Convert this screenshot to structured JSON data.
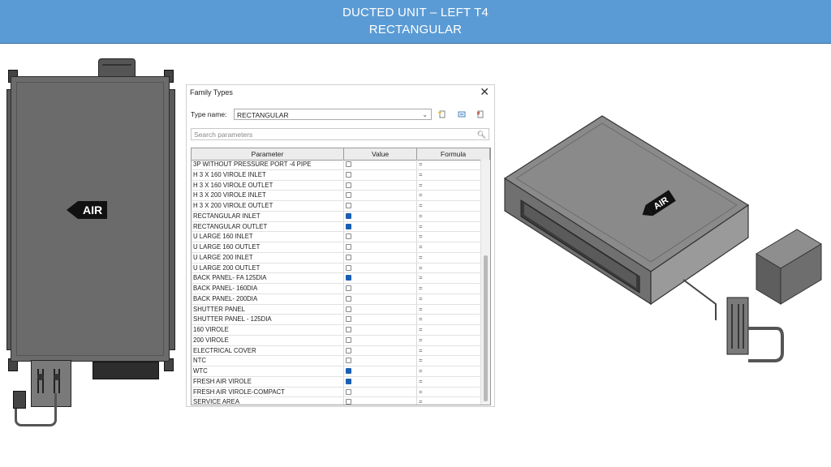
{
  "header": {
    "title_line1": "DUCTED UNIT – LEFT T4",
    "title_line2": "RECTANGULAR",
    "background": "#5b9bd5"
  },
  "front_view": {
    "air_label": "AIR"
  },
  "dialog": {
    "title": "Family Types",
    "type_name_label": "Type name:",
    "type_name_value": "RECTANGULAR",
    "search_placeholder": "Search parameters",
    "columns": {
      "parameter": "Parameter",
      "value": "Value",
      "formula": "Formula"
    },
    "rows": [
      {
        "name": "3P WITHOUT PRESSURE PORT -4  PIPE",
        "checked": false,
        "formula": "="
      },
      {
        "name": "H  3 X 160 VIROLE INLET",
        "checked": false,
        "formula": "="
      },
      {
        "name": "H  3 X 160 VIROLE OUTLET",
        "checked": false,
        "formula": "="
      },
      {
        "name": "H  3 X 200 VIROLE INLET",
        "checked": false,
        "formula": "="
      },
      {
        "name": "H  3 X 200 VIROLE OUTLET",
        "checked": false,
        "formula": "="
      },
      {
        "name": "RECTANGULAR INLET",
        "checked": true,
        "formula": "="
      },
      {
        "name": "RECTANGULAR OUTLET",
        "checked": true,
        "formula": "="
      },
      {
        "name": "U LARGE 160 INLET",
        "checked": false,
        "formula": "="
      },
      {
        "name": "U LARGE 160 OUTLET",
        "checked": false,
        "formula": "="
      },
      {
        "name": "U LARGE 200 INLET",
        "checked": false,
        "formula": "="
      },
      {
        "name": "U LARGE 200 OUTLET",
        "checked": false,
        "formula": "="
      },
      {
        "name": "BACK PANEL- FA 125DIA",
        "checked": true,
        "formula": "="
      },
      {
        "name": "BACK PANEL- 160DIA",
        "checked": false,
        "formula": "="
      },
      {
        "name": "BACK PANEL- 200DIA",
        "checked": false,
        "formula": "="
      },
      {
        "name": "SHUTTER PANEL",
        "checked": false,
        "formula": "="
      },
      {
        "name": "SHUTTER PANEL - 125DIA",
        "checked": false,
        "formula": "="
      },
      {
        "name": "160 VIROLE",
        "checked": false,
        "formula": "="
      },
      {
        "name": "200 VIROLE",
        "checked": false,
        "formula": "="
      },
      {
        "name": "ELECTRICAL COVER",
        "checked": false,
        "formula": "="
      },
      {
        "name": "NTC",
        "checked": false,
        "formula": "="
      },
      {
        "name": "WTC",
        "checked": true,
        "formula": "="
      },
      {
        "name": "FRESH AIR VIROLE",
        "checked": true,
        "formula": "="
      },
      {
        "name": "FRESH AIR VIROLE-COMPACT",
        "checked": false,
        "formula": "="
      },
      {
        "name": "SERVICE AREA",
        "checked": false,
        "formula": "="
      }
    ]
  },
  "iso_view": {
    "air_label": "AIR"
  }
}
